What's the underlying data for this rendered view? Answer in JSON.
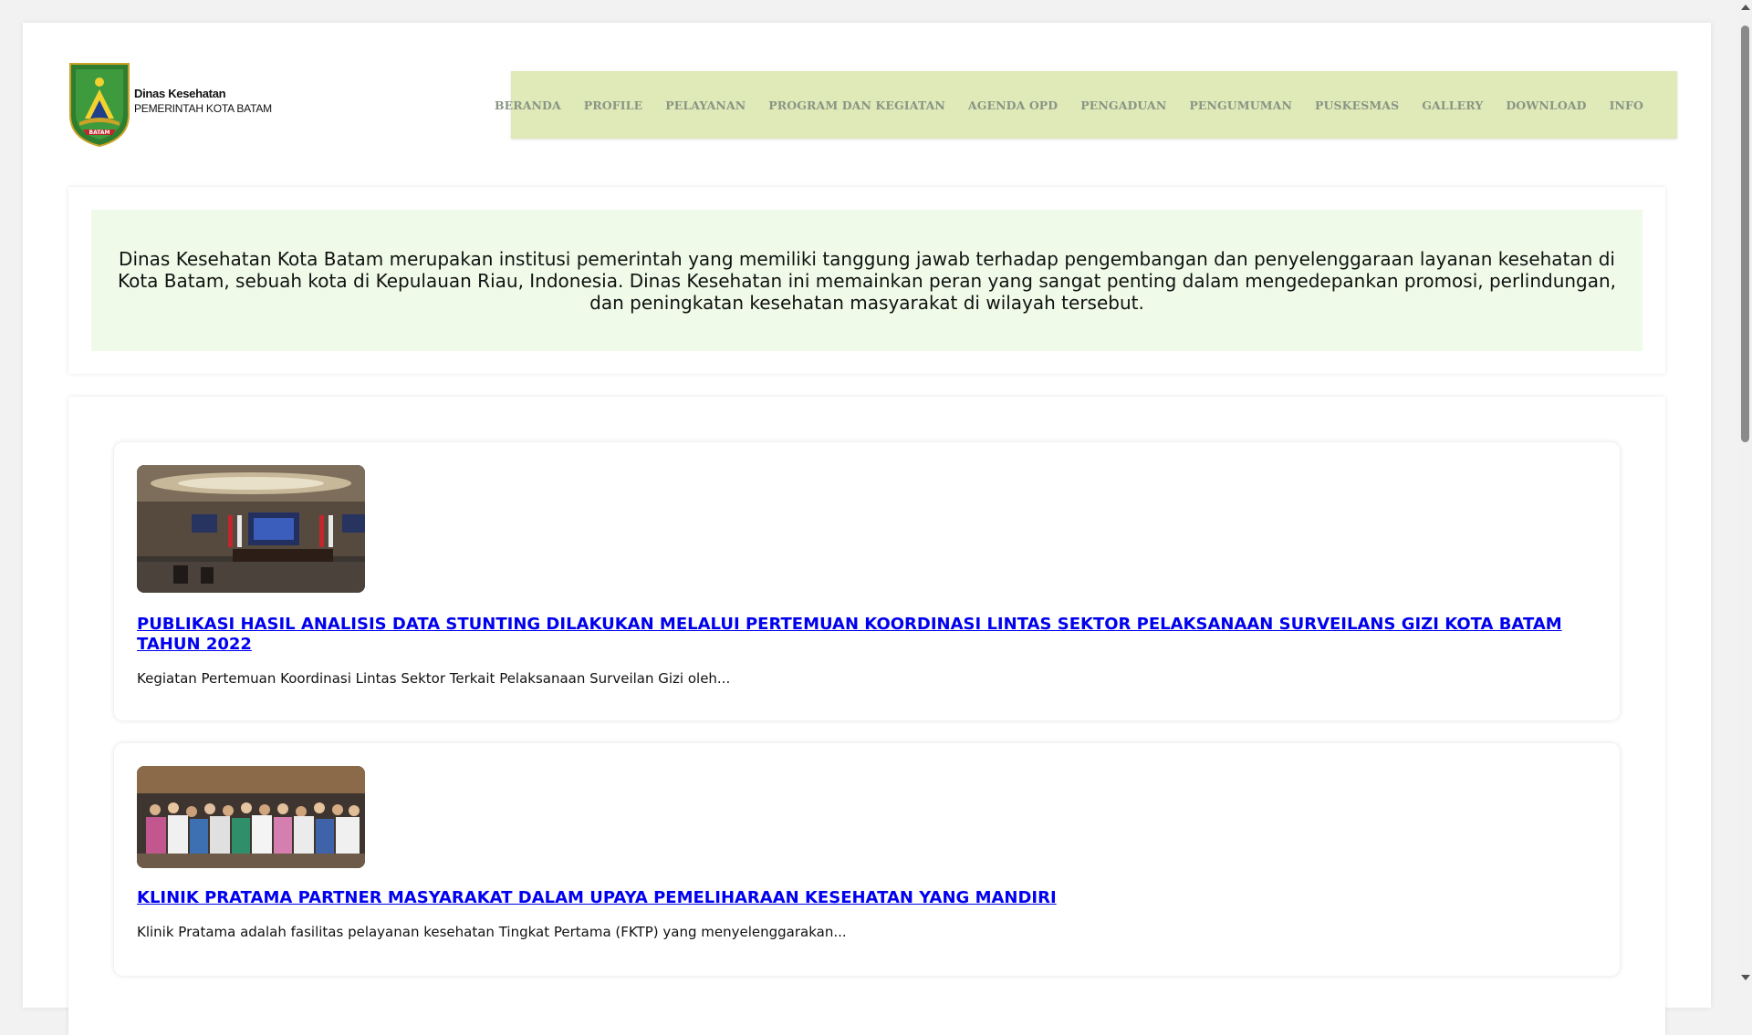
{
  "header": {
    "org_name": "Dinas Kesehatan",
    "org_subtitle": "PEMERINTAH KOTA BATAM",
    "emblem_text": "BATAM"
  },
  "nav": {
    "items": [
      "BERANDA",
      "PROFILE",
      "PELAYANAN",
      "PROGRAM DAN KEGIATAN",
      "AGENDA OPD",
      "PENGADUAN",
      "PENGUMUMAN",
      "PUSKESMAS",
      "GALLERY",
      "DOWNLOAD",
      "INFO"
    ]
  },
  "intro": {
    "text": "Dinas Kesehatan Kota Batam merupakan institusi pemerintah yang memiliki tanggung jawab terhadap pengembangan dan penyelenggaraan layanan kesehatan di Kota Batam, sebuah kota di Kepulauan Riau, Indonesia. Dinas Kesehatan ini memainkan peran yang sangat penting dalam mengedepankan promosi, perlindungan, dan peningkatan kesehatan masyarakat di wilayah tersebut."
  },
  "news": [
    {
      "title": "PUBLIKASI HASIL ANALISIS DATA STUNTING DILAKUKAN MELALUI PERTEMUAN KOORDINASI LINTAS SEKTOR PELAKSANAAN SURVEILANS GIZI KOTA BATAM TAHUN 2022",
      "excerpt": "Kegiatan Pertemuan Koordinasi Lintas Sektor Terkait Pelaksanaan Surveilan Gizi oleh..."
    },
    {
      "title": "KLINIK PRATAMA PARTNER MASYARAKAT DALAM UPAYA PEMELIHARAAN KESEHATAN YANG MANDIRI",
      "excerpt": "Klinik Pratama adalah fasilitas pelayanan kesehatan Tingkat Pertama (FKTP) yang menyelenggarakan..."
    }
  ],
  "colors": {
    "nav_bg": "#dfeab8",
    "nav_text": "#8a9585",
    "intro_bg": "#effbe8",
    "link": "#0000ee"
  }
}
